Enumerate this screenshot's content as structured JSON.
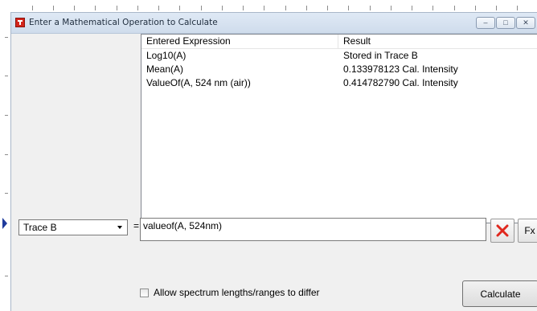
{
  "window": {
    "title": "Enter a Mathematical Operation to Calculate"
  },
  "titlebar_buttons": [
    {
      "name": "minimize",
      "glyph": "–"
    },
    {
      "name": "maximize",
      "glyph": "□"
    },
    {
      "name": "close",
      "glyph": "✕"
    }
  ],
  "list": {
    "headers": {
      "expression": "Entered Expression",
      "result": "Result"
    },
    "rows": [
      {
        "expression": "Log10(A)",
        "result": "Stored in Trace B"
      },
      {
        "expression": "Mean(A)",
        "result": "0.133978123 Cal. Intensity"
      },
      {
        "expression": "ValueOf(A, 524 nm (air))",
        "result": "0.414782790 Cal. Intensity"
      }
    ]
  },
  "operation": {
    "target_selected": "Trace B",
    "equals": "=",
    "expression_value": "valueof(A, 524nm)",
    "clear_icon": "red-x-icon",
    "fx_label": "Fx"
  },
  "options": {
    "allow_differ_label": "Allow spectrum lengths/ranges to differ",
    "allow_differ_checked": false
  },
  "actions": {
    "calculate_label": "Calculate"
  },
  "colors": {
    "accent_red": "#e0271d",
    "titlebar": "#dfe9f5",
    "dialog_bg": "#f0f0f0"
  }
}
